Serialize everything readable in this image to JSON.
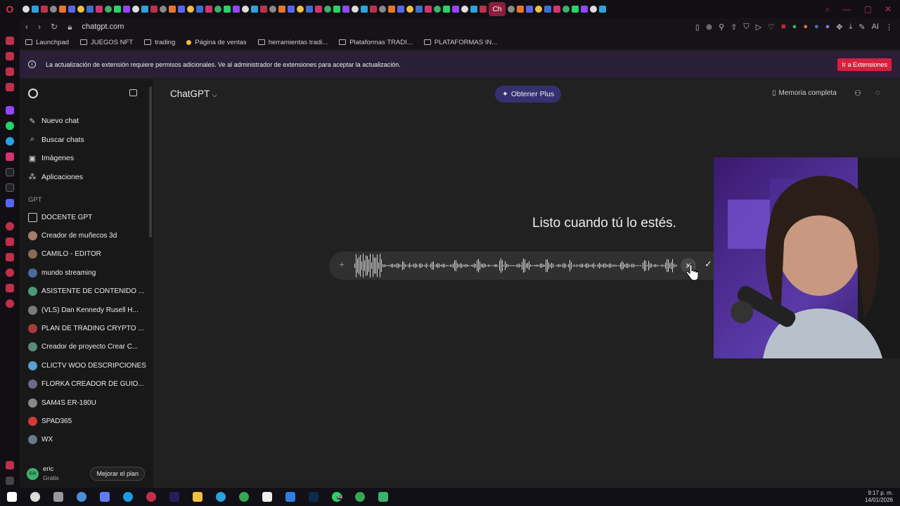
{
  "browser": {
    "url": "chatgpt.com",
    "active_tab": "Ch",
    "ai_label": "AI",
    "bookmarks": [
      "Launchpad",
      "JUEGOS NFT",
      "trading",
      "Página de ventas",
      "herramientas tradi...",
      "Plataformas TRADI...",
      "PLATAFORMAS IN..."
    ],
    "notice": {
      "text": "La actualización de extensión requiere permisos adicionales. Ve al administrador de extensiones para aceptar la actualización.",
      "button": "Ir a Extensiones"
    }
  },
  "sidebar": {
    "menu": [
      {
        "label": "Nuevo chat",
        "icon": "edit-icon"
      },
      {
        "label": "Buscar chats",
        "icon": "search-icon"
      },
      {
        "label": "Imágenes",
        "icon": "image-icon"
      },
      {
        "label": "Aplicaciones",
        "icon": "apps-icon"
      }
    ],
    "section_label": "GPT",
    "gpts": [
      "DOCENTE GPT",
      "Creador de muñecos 3d",
      "CAMILO - EDITOR",
      "mundo streaming",
      "ASISTENTE DE CONTENIDO ...",
      "(VLS) Dan Kennedy Rusell H...",
      "PLAN DE TRADING CRYPTO ...",
      "Creador de proyecto Crear C...",
      "CLICTV WOO DESCRIPCIONES",
      "FLORKA CREADOR DE GUIO...",
      "SAM4S ER-180U",
      "SPAD365",
      "WX"
    ],
    "user": {
      "name": "eric",
      "plan": "Gratis",
      "initials": "ER",
      "upgrade": "Mejorar el plan"
    }
  },
  "main": {
    "title": "ChatGPT",
    "get_plus": "Obtener Plus",
    "memory": "Memoria completa",
    "ready_text": "Listo cuando tú lo estés."
  },
  "taskbar": {
    "time": "9:17 p. m.",
    "date": "14/01/2026",
    "badge": "64"
  },
  "colors": {
    "accent_red": "#d4213d",
    "plus_button": "#353070",
    "background": "#212121"
  }
}
